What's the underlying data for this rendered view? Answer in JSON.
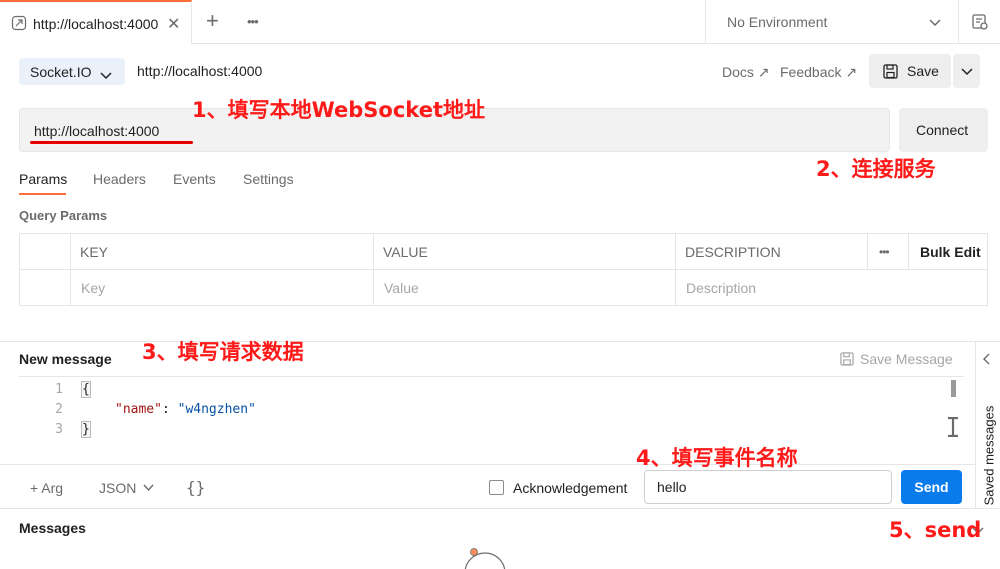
{
  "tabbar": {
    "tab_label": "http://localhost:4000",
    "close_glyph": "✕",
    "new_tab_glyph": "+",
    "more_glyph": "•••",
    "environment": "No Environment"
  },
  "request": {
    "protocol": "Socket.IO",
    "name": "http://localhost:4000",
    "docs": "Docs ↗",
    "feedback": "Feedback ↗",
    "save": "Save",
    "url": "http://localhost:4000",
    "connect": "Connect"
  },
  "tabs": [
    "Params",
    "Headers",
    "Events",
    "Settings"
  ],
  "active_tab": "Params",
  "params": {
    "title": "Query Params",
    "columns": [
      "KEY",
      "VALUE",
      "DESCRIPTION"
    ],
    "more": "•••",
    "bulk_edit": "Bulk Edit",
    "placeholders": [
      "Key",
      "Value",
      "Description"
    ]
  },
  "message": {
    "title": "New message",
    "save_message": "Save Message",
    "saved_messages": "Saved messages",
    "lines": [
      "1",
      "2",
      "3"
    ],
    "code_open": "{",
    "code_key": "\"name\"",
    "code_colon": ": ",
    "code_value": "\"w4ngzhen\"",
    "code_close": "}",
    "arg": "+  Arg",
    "format": "JSON",
    "beautify": "{}",
    "acknowledgement": "Acknowledgement",
    "event_name": "hello",
    "send": "Send"
  },
  "messages": {
    "title": "Messages"
  },
  "annotations": {
    "a1": "1、填写本地WebSocket地址",
    "a2": "2、连接服务",
    "a3": "3、填写请求数据",
    "a4": "4、填写事件名称",
    "a5": "5、send"
  },
  "icons": {
    "tab": "socketio-request-icon",
    "env": "environment-quicklook-icon",
    "save": "floppy-disk-icon"
  },
  "colors": {
    "accent": "#ff6c37",
    "send": "#097bed",
    "annotation": "#ff1a1a"
  }
}
